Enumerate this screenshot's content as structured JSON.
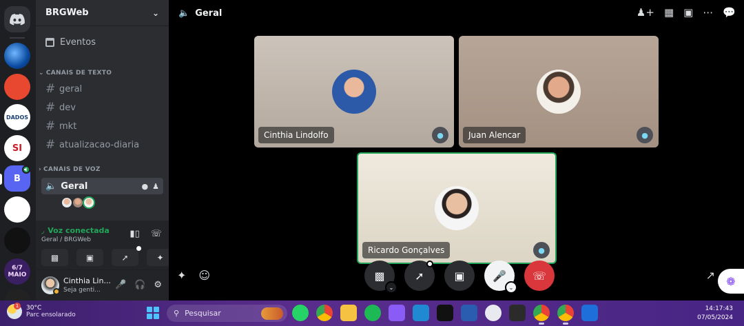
{
  "server": {
    "name": "BRGWeb"
  },
  "servers": [
    {
      "label": ""
    },
    {
      "label": ""
    },
    {
      "label": "DADOS"
    },
    {
      "label": "SI"
    },
    {
      "label": "B"
    },
    {
      "label": ""
    },
    {
      "label": ""
    },
    {
      "label": "6/7 MAIO"
    }
  ],
  "sidebar": {
    "events_label": "Eventos",
    "text_category": "CANAIS DE TEXTO",
    "text_channels": [
      "geral",
      "dev",
      "mkt",
      "atualizacao-diaria"
    ],
    "voice_category": "CANAIS DE VOZ",
    "voice_channel": "Geral"
  },
  "voice_panel": {
    "status": "Voz conectada",
    "location": "Geral / BRGWeb"
  },
  "user": {
    "name": "Cinthia Lin...",
    "custom_status": "Seja genti..."
  },
  "main": {
    "channel_title": "Geral",
    "participants": [
      {
        "name": "Cinthia Lindolfo"
      },
      {
        "name": "Juan Alencar"
      },
      {
        "name": "Ricardo Gonçalves"
      }
    ]
  },
  "taskbar": {
    "temperature": "30°C",
    "weather_desc": "Parc ensolarado",
    "weather_badge": "1",
    "search_placeholder": "Pesquisar",
    "time": "14:17:43",
    "date": "07/05/2024"
  },
  "colors": {
    "accent": "#5865f2",
    "connected": "#23a559",
    "leave": "#da373c",
    "speaking_border": "#23a559"
  }
}
